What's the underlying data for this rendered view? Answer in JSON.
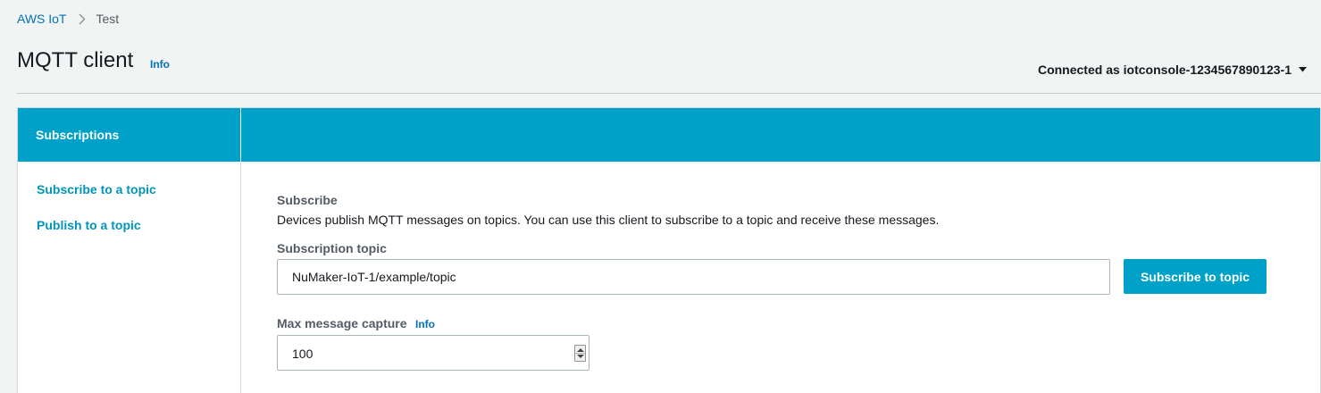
{
  "breadcrumb": {
    "root": "AWS IoT",
    "current": "Test"
  },
  "header": {
    "title": "MQTT client",
    "info": "Info",
    "connected_label": "Connected as iotconsole-1234567890123-1"
  },
  "sidebar": {
    "title": "Subscriptions",
    "items": [
      {
        "label": "Subscribe to a topic"
      },
      {
        "label": "Publish to a topic"
      }
    ]
  },
  "subscribe": {
    "section_title": "Subscribe",
    "description": "Devices publish MQTT messages on topics. You can use this client to subscribe to a topic and receive these messages.",
    "topic_label": "Subscription topic",
    "topic_value": "NuMaker-IoT-1/example/topic",
    "button_label": "Subscribe to topic",
    "max_label": "Max message capture",
    "max_info": "Info",
    "max_value": "100"
  },
  "colors": {
    "accent": "#00a1c9",
    "link": "#0073bb",
    "nav_link": "#0095b9",
    "background": "#f2f3f3"
  },
  "icons": {
    "breadcrumb_separator": "chevron-right-icon",
    "connection_menu": "caret-down-icon",
    "stepper": "spinner-arrows-icon"
  }
}
